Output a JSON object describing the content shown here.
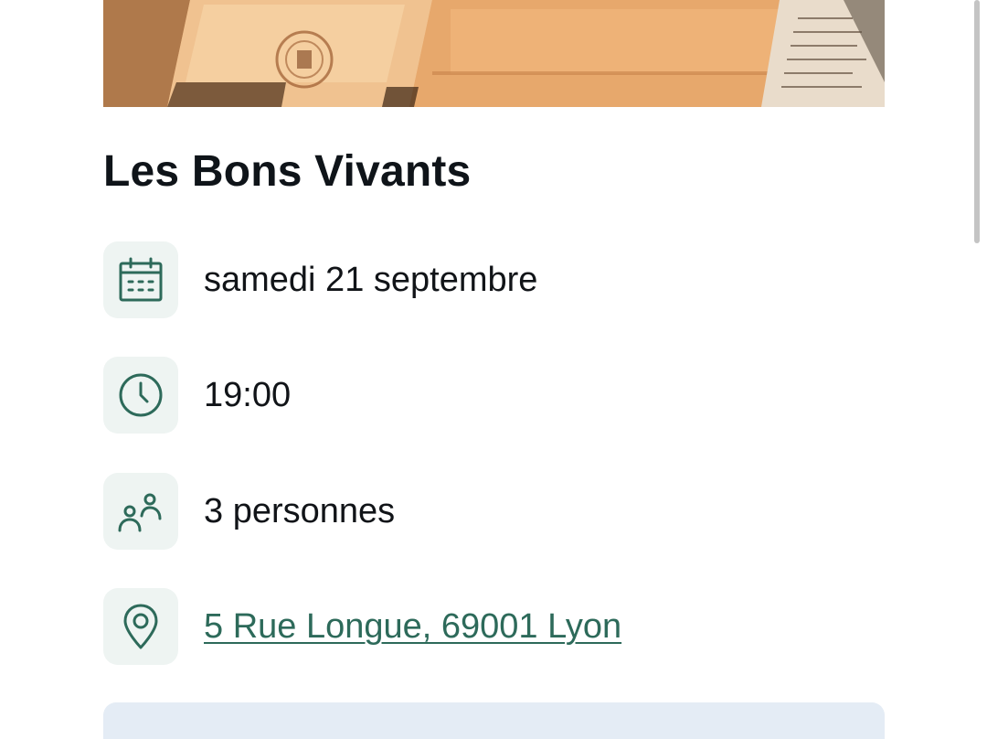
{
  "venue": {
    "name": "Les Bons Vivants"
  },
  "details": {
    "date": {
      "icon": "calendar-icon",
      "text": "samedi 21 septembre"
    },
    "time": {
      "icon": "clock-icon",
      "text": "19:00"
    },
    "guests": {
      "icon": "people-icon",
      "text": "3 personnes"
    },
    "address": {
      "icon": "location-pin-icon",
      "text": "5 Rue Longue, 69001 Lyon"
    }
  },
  "colors": {
    "accent": "#2d6a5a",
    "icon_background": "#eef4f2",
    "cta_background": "#e4ecf5"
  }
}
